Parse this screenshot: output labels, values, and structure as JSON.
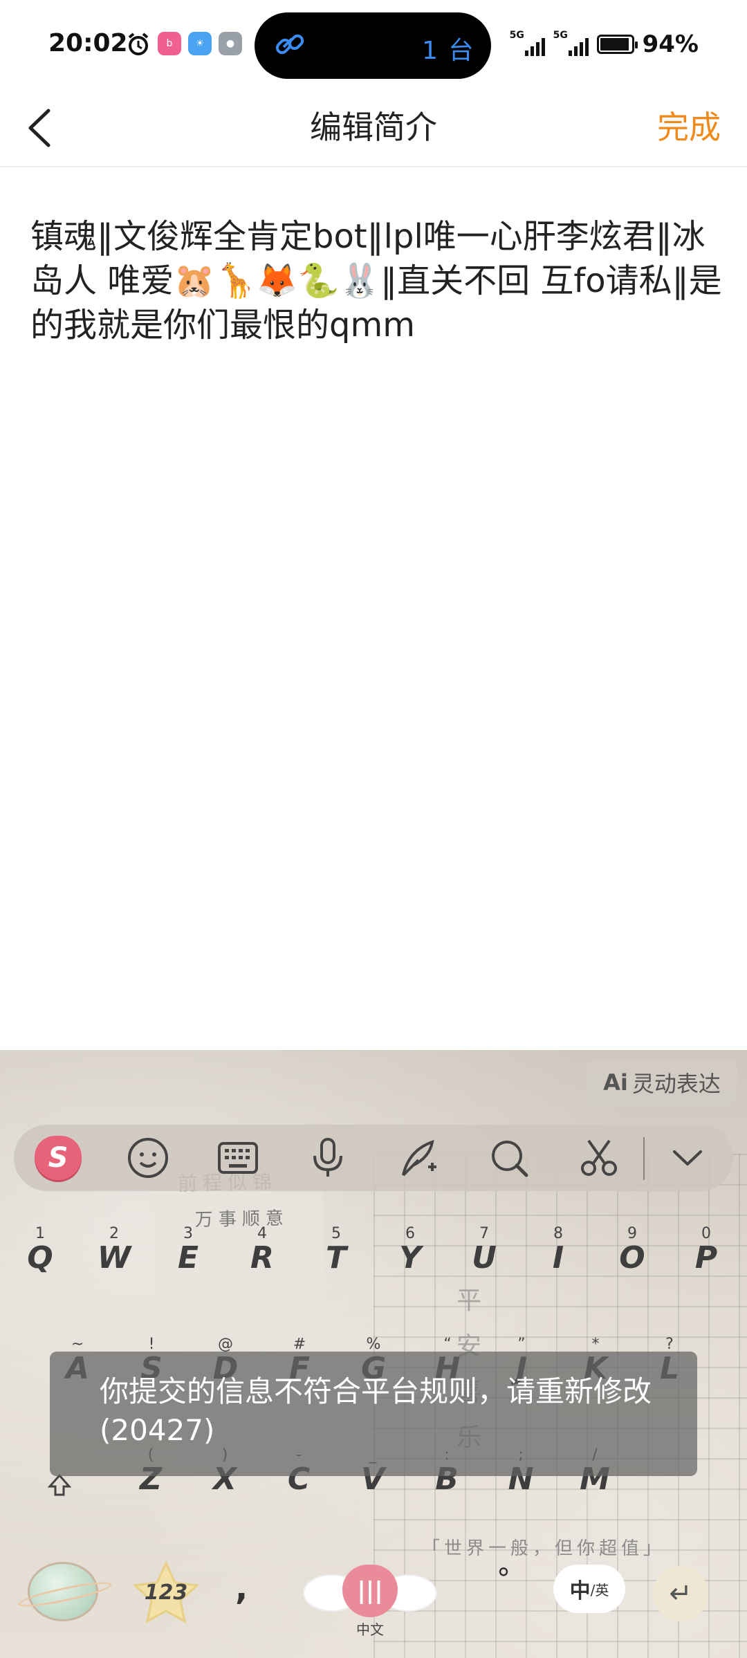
{
  "status_bar": {
    "time": "20:02",
    "island_count": "1 台",
    "net1": "5G",
    "net2": "5G",
    "battery": "94%",
    "battery_level": 0.94
  },
  "nav": {
    "title": "编辑简介",
    "done_label": "完成"
  },
  "bio": {
    "text": "镇魂‖文俊辉全肯定bot‖lpl唯一心肝李炫君‖冰岛人 唯爱🐹🦒🦊🐍🐰‖直关不回 互fo请私‖是的我就是你们最恨的qmm"
  },
  "keyboard": {
    "ai_label": "灵动表达",
    "ai_prefix": "Ai",
    "sogou_letter": "S",
    "note_line1": "前程似锦",
    "note_line2": "万事顺意",
    "vertical_text": "平安喜乐",
    "motto": "「世界一般，但你超值」",
    "row1": [
      {
        "num": "1",
        "key": "Q"
      },
      {
        "num": "2",
        "key": "W"
      },
      {
        "num": "3",
        "key": "E"
      },
      {
        "num": "4",
        "key": "R"
      },
      {
        "num": "5",
        "key": "T"
      },
      {
        "num": "6",
        "key": "Y"
      },
      {
        "num": "7",
        "key": "U"
      },
      {
        "num": "8",
        "key": "I"
      },
      {
        "num": "9",
        "key": "O"
      },
      {
        "num": "0",
        "key": "P"
      }
    ],
    "row2": [
      {
        "num": "~",
        "key": "A"
      },
      {
        "num": "!",
        "key": "S"
      },
      {
        "num": "@",
        "key": "D"
      },
      {
        "num": "#",
        "key": "F"
      },
      {
        "num": "%",
        "key": "G"
      },
      {
        "num": "“",
        "key": "H"
      },
      {
        "num": "”",
        "key": "J"
      },
      {
        "num": "*",
        "key": "K"
      },
      {
        "num": "?",
        "key": "L"
      }
    ],
    "row3": [
      {
        "num": "(",
        "key": "Z"
      },
      {
        "num": ")",
        "key": "X"
      },
      {
        "num": "-",
        "key": "C"
      },
      {
        "num": "_",
        "key": "V"
      },
      {
        "num": ":",
        "key": "B"
      },
      {
        "num": ";",
        "key": "N"
      },
      {
        "num": "/",
        "key": "M"
      }
    ],
    "num_key": "123",
    "comma": ",",
    "space_sub": "中文",
    "period": "°",
    "lang_main": "中",
    "lang_sub": "/英",
    "enter": "↵"
  },
  "toast": {
    "message": "你提交的信息不符合平台规则，请重新修改(20427)"
  }
}
